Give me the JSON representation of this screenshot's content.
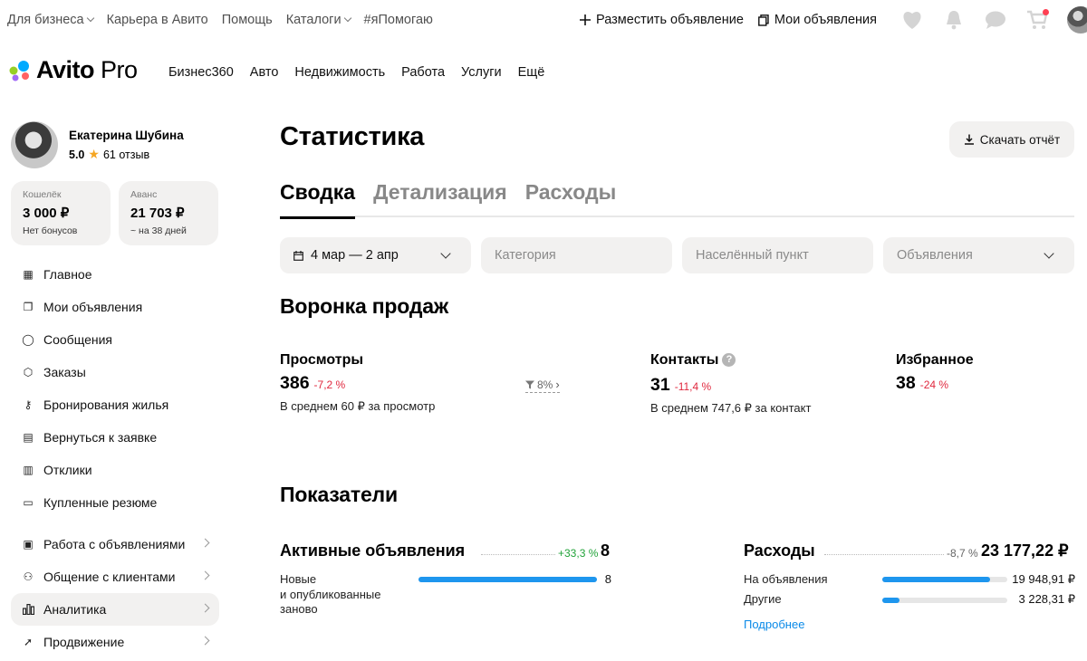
{
  "topbar": {
    "links": [
      {
        "label": "Для бизнеса",
        "dropdown": true
      },
      {
        "label": "Карьера в Авито",
        "dropdown": false
      },
      {
        "label": "Помощь",
        "dropdown": false
      },
      {
        "label": "Каталоги",
        "dropdown": true
      },
      {
        "label": "#яПомогаю",
        "dropdown": false
      }
    ],
    "post_ad": "Разместить объявление",
    "my_ads": "Мои объявления"
  },
  "header": {
    "logo_main": "Avito",
    "logo_pro": "Pro",
    "nav": [
      "Бизнес360",
      "Авто",
      "Недвижимость",
      "Работа",
      "Услуги",
      "Ещё"
    ]
  },
  "profile": {
    "name": "Екатерина Шубина",
    "rating": "5.0",
    "reviews": "61 отзыв"
  },
  "wallet": {
    "label": "Кошелёк",
    "value": "3 000 ₽",
    "sub": "Нет бонусов"
  },
  "advance": {
    "label": "Аванс",
    "value": "21 703 ₽",
    "sub": "~ на 38 дней"
  },
  "sidebar": {
    "items": [
      {
        "label": "Главное",
        "icon": "grid-icon",
        "glyph": "▦"
      },
      {
        "label": "Мои объявления",
        "icon": "copy-icon",
        "glyph": "❐"
      },
      {
        "label": "Сообщения",
        "icon": "chat-icon",
        "glyph": "◯"
      },
      {
        "label": "Заказы",
        "icon": "box-icon",
        "glyph": "⬡"
      },
      {
        "label": "Бронирования жилья",
        "icon": "key-icon",
        "glyph": "⚷"
      },
      {
        "label": "Вернуться к заявке",
        "icon": "document-icon",
        "glyph": "▤"
      },
      {
        "label": "Отклики",
        "icon": "list-icon",
        "glyph": "▥"
      },
      {
        "label": "Купленные резюме",
        "icon": "resume-icon",
        "glyph": "▭"
      }
    ],
    "groups": [
      {
        "label": "Работа с объявлениями",
        "icon": "ads-work-icon",
        "glyph": "▣",
        "active": false
      },
      {
        "label": "Общение с клиентами",
        "icon": "users-icon",
        "glyph": "⚇",
        "active": false
      },
      {
        "label": "Аналитика",
        "icon": "analytics-icon",
        "glyph": "▮",
        "active": true
      },
      {
        "label": "Продвижение",
        "icon": "rocket-icon",
        "glyph": "➚",
        "active": false
      }
    ]
  },
  "page": {
    "title": "Статистика",
    "download_label": "Скачать отчёт",
    "tabs": [
      "Сводка",
      "Детализация",
      "Расходы"
    ],
    "active_tab": 0
  },
  "filters": {
    "date": "4 мар — 2 апр",
    "category_placeholder": "Категория",
    "city_placeholder": "Населённый пункт",
    "ads_placeholder": "Объявления"
  },
  "funnel": {
    "title": "Воронка продаж",
    "views": {
      "label": "Просмотры",
      "value": "386",
      "delta": "-7,2 %",
      "sub": "В среднем 60 ₽ за просмотр"
    },
    "conversion": "8%",
    "contacts": {
      "label": "Контакты",
      "value": "31",
      "delta": "-11,4 %",
      "sub": "В среднем 747,6 ₽ за контакт"
    },
    "favorites": {
      "label": "Избранное",
      "value": "38",
      "delta": "-24 %"
    }
  },
  "indicators": {
    "title": "Показатели",
    "active_ads": {
      "label": "Активные объявления",
      "delta": "+33,3 %",
      "value": "8",
      "rows": [
        {
          "label": "Новые\nи опубликованные\nзаново",
          "value": "8",
          "fill": 1.0
        }
      ]
    },
    "expenses": {
      "label": "Расходы",
      "delta": "-8,7 %",
      "value": "23 177,22 ₽",
      "rows": [
        {
          "label": "На объявления",
          "value": "19 948,91 ₽",
          "fill": 0.86
        },
        {
          "label": "Другие",
          "value": "3 228,31 ₽",
          "fill": 0.14
        }
      ],
      "more_link": "Подробнее"
    }
  },
  "colors": {
    "accent": "#1e96ee",
    "negative": "#e0283e",
    "positive": "#22a33a",
    "surface": "#f2f1f0"
  }
}
